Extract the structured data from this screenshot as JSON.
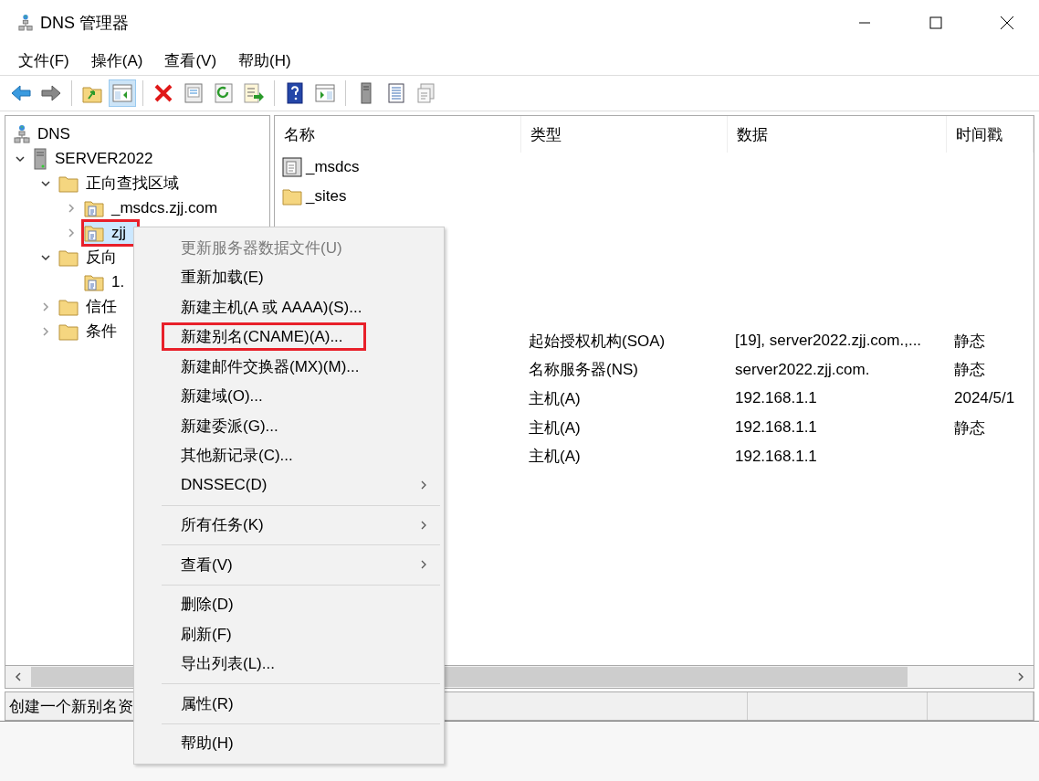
{
  "window": {
    "title": "DNS 管理器"
  },
  "menubar": [
    "文件(F)",
    "操作(A)",
    "查看(V)",
    "帮助(H)"
  ],
  "toolbar": [
    {
      "kind": "back",
      "pressed": false
    },
    {
      "kind": "forward",
      "pressed": false
    },
    {
      "kind": "sep"
    },
    {
      "kind": "up",
      "pressed": false
    },
    {
      "kind": "tree",
      "pressed": true
    },
    {
      "kind": "sep"
    },
    {
      "kind": "delete",
      "pressed": false
    },
    {
      "kind": "props",
      "pressed": false
    },
    {
      "kind": "refresh",
      "pressed": false
    },
    {
      "kind": "export",
      "pressed": false
    },
    {
      "kind": "sep"
    },
    {
      "kind": "help",
      "pressed": false
    },
    {
      "kind": "pane",
      "pressed": false
    },
    {
      "kind": "sep"
    },
    {
      "kind": "server",
      "pressed": false
    },
    {
      "kind": "list",
      "pressed": false
    },
    {
      "kind": "copy",
      "pressed": false
    }
  ],
  "tree": [
    {
      "label": "DNS",
      "kind": "root",
      "children": [
        {
          "label": "SERVER2022",
          "kind": "server",
          "expanded": true,
          "children": [
            {
              "label": "正向查找区域",
              "kind": "folder",
              "expanded": true,
              "children": [
                {
                  "label": "_msdcs.zjj.com",
                  "kind": "zone",
                  "expanded": false,
                  "selected": false,
                  "highlighted": false
                },
                {
                  "label": "zjj",
                  "kind": "zone",
                  "expanded": false,
                  "selected": true,
                  "highlighted": true
                }
              ]
            },
            {
              "label": "反向",
              "kind": "folder",
              "expanded": true,
              "children": [
                {
                  "label": "1.",
                  "kind": "zone"
                }
              ]
            },
            {
              "label": "信任",
              "kind": "folder",
              "expanded": false
            },
            {
              "label": "条件",
              "kind": "folder",
              "expanded": false
            }
          ]
        }
      ]
    }
  ],
  "list": {
    "columns": [
      "名称",
      "类型",
      "数据",
      "时间戳"
    ],
    "folders": [
      {
        "name": "_msdcs",
        "kind": "delegation"
      },
      {
        "name": "_sites",
        "kind": "folder"
      }
    ],
    "records": [
      {
        "type": "起始授权机构(SOA)",
        "data": "[19], server2022.zjj.com.,...",
        "time": "静态"
      },
      {
        "type": "名称服务器(NS)",
        "data": "server2022.zjj.com.",
        "time": "静态"
      },
      {
        "type": "主机(A)",
        "data": "192.168.1.1",
        "time": "2024/5/1"
      },
      {
        "type": "主机(A)",
        "data": "192.168.1.1",
        "time": "静态"
      },
      {
        "type": "主机(A)",
        "data": "192.168.1.1"
      }
    ]
  },
  "status_bar": {
    "text": "创建一个新别名资"
  },
  "context_menu": [
    {
      "kind": "item",
      "label": "更新服务器数据文件(U)",
      "disabled": true,
      "submenu": false,
      "highlighted": false
    },
    {
      "kind": "item",
      "label": "重新加载(E)",
      "disabled": false,
      "submenu": false,
      "highlighted": false
    },
    {
      "kind": "item",
      "label": "新建主机(A 或 AAAA)(S)...",
      "disabled": false,
      "submenu": false,
      "highlighted": false
    },
    {
      "kind": "item",
      "label": "新建别名(CNAME)(A)...",
      "disabled": false,
      "submenu": false,
      "highlighted": true
    },
    {
      "kind": "item",
      "label": "新建邮件交换器(MX)(M)...",
      "disabled": false,
      "submenu": false,
      "highlighted": false
    },
    {
      "kind": "item",
      "label": "新建域(O)...",
      "disabled": false,
      "submenu": false,
      "highlighted": false
    },
    {
      "kind": "item",
      "label": "新建委派(G)...",
      "disabled": false,
      "submenu": false,
      "highlighted": false
    },
    {
      "kind": "item",
      "label": "其他新记录(C)...",
      "disabled": false,
      "submenu": false,
      "highlighted": false
    },
    {
      "kind": "item",
      "label": "DNSSEC(D)",
      "disabled": false,
      "submenu": true,
      "highlighted": false
    },
    {
      "kind": "separator"
    },
    {
      "kind": "item",
      "label": "所有任务(K)",
      "disabled": false,
      "submenu": true,
      "highlighted": false
    },
    {
      "kind": "separator"
    },
    {
      "kind": "item",
      "label": "查看(V)",
      "disabled": false,
      "submenu": true,
      "highlighted": false
    },
    {
      "kind": "separator"
    },
    {
      "kind": "item",
      "label": "删除(D)",
      "disabled": false,
      "submenu": false,
      "highlighted": false
    },
    {
      "kind": "item",
      "label": "刷新(F)",
      "disabled": false,
      "submenu": false,
      "highlighted": false
    },
    {
      "kind": "item",
      "label": "导出列表(L)...",
      "disabled": false,
      "submenu": false,
      "highlighted": false
    },
    {
      "kind": "separator"
    },
    {
      "kind": "item",
      "label": "属性(R)",
      "disabled": false,
      "submenu": false,
      "highlighted": false
    },
    {
      "kind": "separator"
    },
    {
      "kind": "item",
      "label": "帮助(H)",
      "disabled": false,
      "submenu": false,
      "highlighted": false
    }
  ]
}
